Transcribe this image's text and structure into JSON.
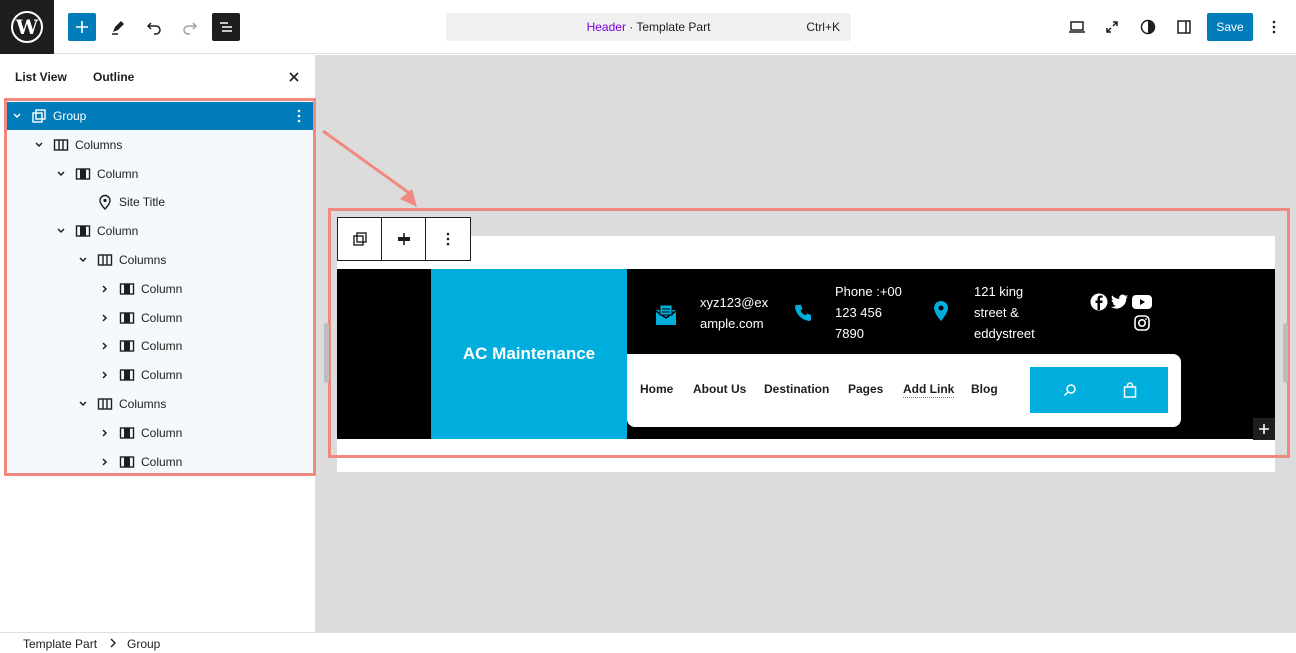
{
  "toolbar": {
    "command_accent": "Header",
    "command_rest": " · Template Part",
    "command_shortcut": "Ctrl+K",
    "save_label": "Save"
  },
  "sidebar": {
    "tab_list_view": "List View",
    "tab_outline": "Outline"
  },
  "tree": [
    {
      "label": "Group",
      "depth": 0,
      "chevron": "down",
      "icon": "group-icon",
      "selected": true
    },
    {
      "label": "Columns",
      "depth": 1,
      "chevron": "down",
      "icon": "columns-icon"
    },
    {
      "label": "Column",
      "depth": 2,
      "chevron": "down",
      "icon": "column-icon"
    },
    {
      "label": "Site Title",
      "depth": 3,
      "chevron": "none",
      "icon": "map-marker-icon"
    },
    {
      "label": "Column",
      "depth": 2,
      "chevron": "down",
      "icon": "column-icon"
    },
    {
      "label": "Columns",
      "depth": 3,
      "chevron": "down",
      "icon": "columns-icon"
    },
    {
      "label": "Column",
      "depth": 4,
      "chevron": "right",
      "icon": "column-icon"
    },
    {
      "label": "Column",
      "depth": 4,
      "chevron": "right",
      "icon": "column-icon"
    },
    {
      "label": "Column",
      "depth": 4,
      "chevron": "right",
      "icon": "column-icon"
    },
    {
      "label": "Column",
      "depth": 4,
      "chevron": "right",
      "icon": "column-icon"
    },
    {
      "label": "Columns",
      "depth": 3,
      "chevron": "down",
      "icon": "columns-icon"
    },
    {
      "label": "Column",
      "depth": 4,
      "chevron": "right",
      "icon": "column-icon"
    },
    {
      "label": "Column",
      "depth": 4,
      "chevron": "right",
      "icon": "column-icon"
    }
  ],
  "breadcrumb": {
    "item_1": "Template Part",
    "item_2": "Group"
  },
  "site": {
    "brand": "AC Maintenance",
    "email_line1": "xyz123@ex",
    "email_line2": "ample.com",
    "phone_line1": "Phone :+00",
    "phone_line2": "123 456",
    "phone_line3": "7890",
    "address_line1": "121 king",
    "address_line2": "street &",
    "address_line3": "eddystreet",
    "nav": [
      "Home",
      "About Us",
      "Destination",
      "Pages",
      "Add Link",
      "Blog"
    ]
  },
  "colors": {
    "wp_blue": "#007cba",
    "accent_purple": "#7a00df",
    "brand_cyan": "#00aedd",
    "highlight_border": "#f08a80"
  }
}
